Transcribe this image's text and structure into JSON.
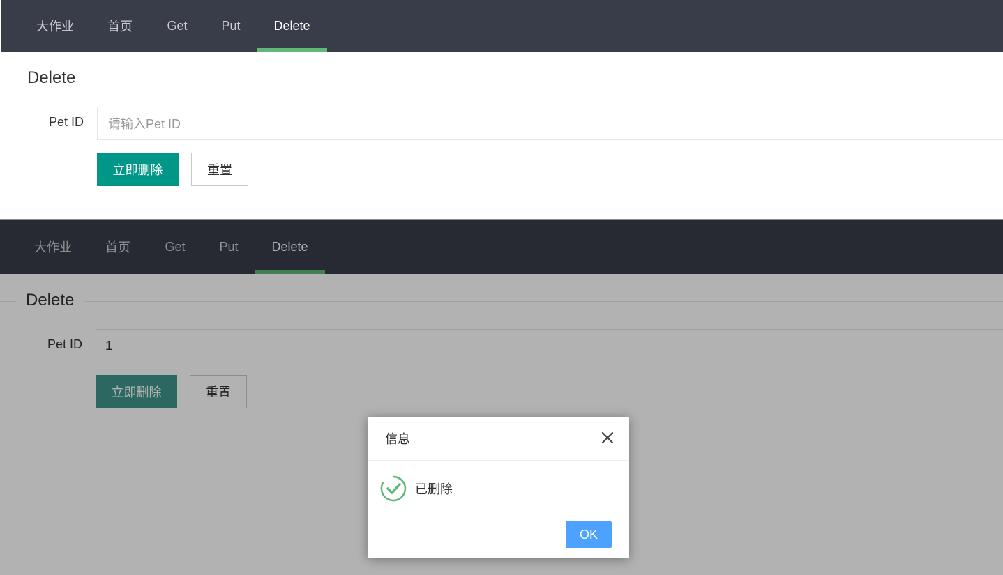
{
  "nav": {
    "items": [
      "大作业",
      "首页",
      "Get",
      "Put",
      "Delete"
    ],
    "active_index": 4,
    "background": "#393d49",
    "active_bar_color": "#5fb878"
  },
  "form": {
    "legend": "Delete",
    "pet_id_label": "Pet ID",
    "pet_id_placeholder": "请输入Pet ID",
    "submit_label": "立即删除",
    "reset_label": "重置"
  },
  "after_submit": {
    "pet_id_value": "1"
  },
  "dialog": {
    "title": "信息",
    "message": "已删除",
    "ok_label": "OK",
    "icon": "success-check-icon",
    "ok_color": "#4da2ff"
  },
  "colors": {
    "primary": "#009688",
    "success": "#5fb878"
  }
}
